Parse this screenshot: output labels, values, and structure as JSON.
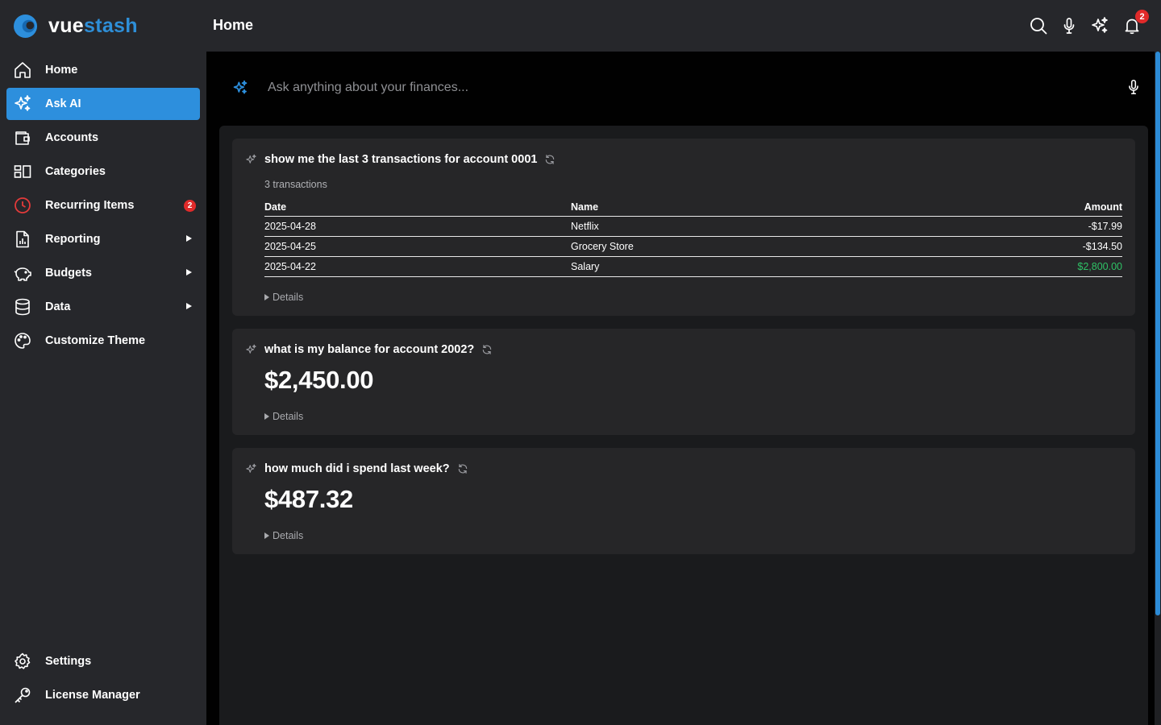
{
  "brand": {
    "name_part1": "vue",
    "name_part2": "stash",
    "accent": "#2d8fdd"
  },
  "header": {
    "title": "Home",
    "notification_count": "2"
  },
  "sidebar": {
    "items": [
      {
        "label": "Home",
        "icon": "home-icon"
      },
      {
        "label": "Ask AI",
        "icon": "sparkles-icon",
        "active": true
      },
      {
        "label": "Accounts",
        "icon": "wallet-icon"
      },
      {
        "label": "Categories",
        "icon": "categories-icon"
      },
      {
        "label": "Recurring Items",
        "icon": "clock-icon",
        "badge": "2"
      },
      {
        "label": "Reporting",
        "icon": "report-icon",
        "expandable": true
      },
      {
        "label": "Budgets",
        "icon": "piggy-bank-icon",
        "expandable": true
      },
      {
        "label": "Data",
        "icon": "database-icon",
        "expandable": true
      },
      {
        "label": "Customize Theme",
        "icon": "palette-icon"
      }
    ],
    "bottom_items": [
      {
        "label": "Settings",
        "icon": "gear-icon"
      },
      {
        "label": "License Manager",
        "icon": "key-icon"
      }
    ]
  },
  "ask": {
    "placeholder": "Ask anything about your finances..."
  },
  "cards": [
    {
      "question": "show me the last 3 transactions for account 0001",
      "subtitle": "3 transactions",
      "table": {
        "headers": [
          "Date",
          "Name",
          "Amount"
        ],
        "rows": [
          [
            "2025-04-28",
            "Netflix",
            "-$17.99"
          ],
          [
            "2025-04-25",
            "Grocery Store",
            "-$134.50"
          ],
          [
            "2025-04-22",
            "Salary",
            "$2,800.00"
          ]
        ]
      },
      "details_label": "Details"
    },
    {
      "question": "what is my balance for account 2002?",
      "value": "$2,450.00",
      "details_label": "Details"
    },
    {
      "question": "how much did i spend last week?",
      "value": "$487.32",
      "details_label": "Details"
    }
  ],
  "colors": {
    "positive_amount": "#2fc266",
    "badge": "#e02a2a"
  }
}
